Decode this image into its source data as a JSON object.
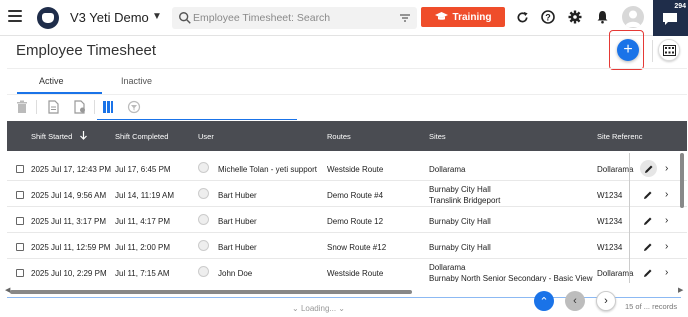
{
  "topbar": {
    "app_title": "V3 Yeti Demo",
    "search_placeholder": "Employee Timesheet: Search",
    "training_label": "Training",
    "chat_badge": "294"
  },
  "page": {
    "title": "Employee Timesheet"
  },
  "tabs": [
    {
      "label": "Active",
      "active": true
    },
    {
      "label": "Inactive",
      "active": false
    }
  ],
  "grid": {
    "columns": [
      "Shift Started",
      "Shift Completed",
      "User",
      "Routes",
      "Sites",
      "Site Referenc"
    ],
    "rows": [
      {
        "shift_started": "2025 Jul 17, 12:43 PM",
        "shift_completed": "Jul 17, 6:45 PM",
        "user": "Michelle Tolan - yeti support",
        "routes": "Westside Route",
        "sites": [
          "Dollarama"
        ],
        "site_ref": "Dollarama"
      },
      {
        "shift_started": "2025 Jul 14, 9:56 AM",
        "shift_completed": "Jul 14, 11:19 AM",
        "user": "Bart Huber",
        "routes": "Demo Route #4",
        "sites": [
          "Burnaby City Hall",
          "Translink Bridgeport"
        ],
        "site_ref": "W1234"
      },
      {
        "shift_started": "2025 Jul 11, 3:17 PM",
        "shift_completed": "Jul 11, 4:17 PM",
        "user": "Bart Huber",
        "routes": "Demo Route 12",
        "sites": [
          "Burnaby City Hall"
        ],
        "site_ref": "W1234"
      },
      {
        "shift_started": "2025 Jul 11, 12:59 PM",
        "shift_completed": "Jul 11, 2:00 PM",
        "user": "Bart Huber",
        "routes": "Snow Route #12",
        "sites": [
          "Burnaby City Hall"
        ],
        "site_ref": "W1234"
      },
      {
        "shift_started": "2025 Jul 10, 2:29 PM",
        "shift_completed": "Jul 11, 7:15 AM",
        "user": "John Doe",
        "routes": "Westside Route",
        "sites": [
          "Dollarama",
          "Burnaby North Senior Secondary - Basic View"
        ],
        "site_ref": "Dollarama"
      }
    ]
  },
  "footer": {
    "loading": "Loading...",
    "records": "15 of ... records"
  },
  "colors": {
    "accent": "#1a73e8",
    "training": "#ef4d2a",
    "header_bg": "#4a4c52",
    "navy": "#1f2d4a"
  }
}
